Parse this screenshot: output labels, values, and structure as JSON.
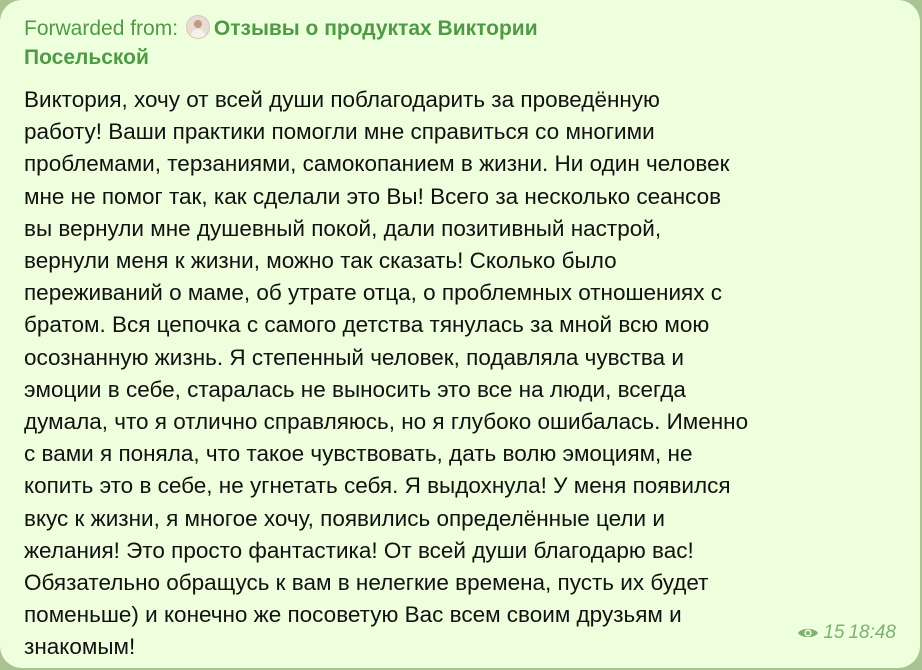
{
  "message": {
    "forwarded_label": "Forwarded from:",
    "source_name": "Отзывы о продуктах Виктории Посельской",
    "text": "Виктория, хочу от всей души поблагодарить за проведённую\nработу! Ваши практики помогли мне справиться со многими\nпроблемами, терзаниями, самокопанием в жизни. Ни один человек\nмне не помог так, как сделали это Вы! Всего за несколько сеансов\nвы вернули мне душевный покой, дали позитивный настрой,\nвернули меня к жизни, можно так сказать! Сколько было\nпереживаний о маме, об утрате отца, о проблемных отношениях с\nбратом. Вся цепочка с самого детства тянулась за мной всю мою\nосознанную жизнь. Я степенный человек, подавляла чувства и\nэмоции в себе, старалась не выносить это все на люди, всегда\nдумала, что я отлично справляюсь, но я глубоко ошибалась. Именно\nс вами я поняла, что такое чувствовать, дать волю эмоциям, не\nкопить это в себе, не угнетать себя. Я выдохнула! У меня появился\nвкус к жизни, я многое хочу, появились определённые цели и\nжелания! Это просто фантастика! От всей души благодарю вас!\nОбязательно обращусь к вам в нелегкие времена, пусть их будет\nпоменьше) и конечно же посоветую Вас всем своим друзьям и\nзнакомым!",
    "views": "15",
    "time": "18:48",
    "views_icon": "eye-icon"
  },
  "colors": {
    "bubble_bg": "#eeffde",
    "accent_green": "#4f9a45",
    "meta_green": "#7fb270",
    "chat_bg": "#a9c393"
  }
}
